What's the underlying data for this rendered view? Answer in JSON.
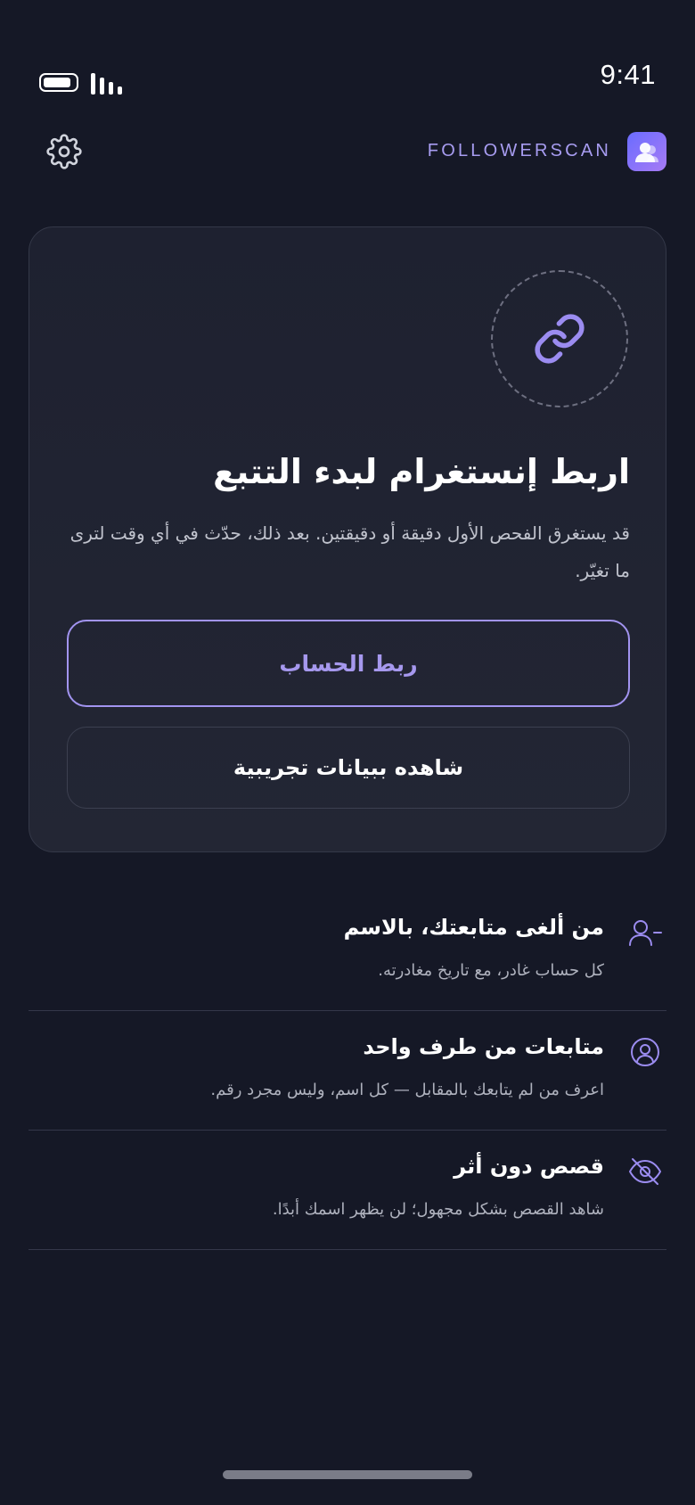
{
  "status_bar": {
    "time": "9:41"
  },
  "header": {
    "brand_name": "FOLLOWERSCAN",
    "settings_icon": "gear-icon",
    "logo_icon": "person-icon"
  },
  "connect_card": {
    "icon": "link-icon",
    "title": "اربط إنستغرام لبدء التتبع",
    "description": "قد يستغرق الفحص الأول دقيقة أو دقيقتين. بعد ذلك، حدّث في أي وقت لترى ما تغيّر.",
    "primary_button": "ربط الحساب",
    "secondary_button": "شاهده ببيانات تجريبية"
  },
  "features": [
    {
      "icon": "user-minus-icon",
      "title": "من ألغى متابعتك، بالاسم",
      "subtitle": "كل حساب غادر، مع تاريخ مغادرته."
    },
    {
      "icon": "user-circle-icon",
      "title": "متابعات من طرف واحد",
      "subtitle": "اعرف من لم يتابعك بالمقابل — كل اسم، وليس مجرد رقم."
    },
    {
      "icon": "eye-off-icon",
      "title": "قصص دون أثر",
      "subtitle": "شاهد القصص بشكل مجهول؛ لن يظهر اسمك أبدًا."
    }
  ],
  "colors": {
    "background": "#151826",
    "accent": "#a294f0",
    "card_border": "#343848"
  }
}
